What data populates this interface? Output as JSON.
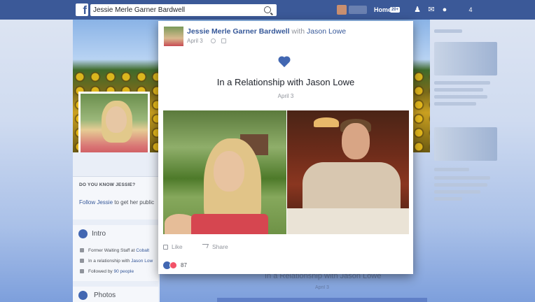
{
  "topbar": {
    "logo": "f",
    "search_value": "Jessie Merle Garner Bardwell",
    "home_label": "Home",
    "home_badge": "20+",
    "account_label": "4"
  },
  "profile": {
    "know_header": "DO YOU KNOW JESSIE?",
    "know_link": "Follow Jessie",
    "know_rest": " to get her public",
    "intro_title": "Intro",
    "intro_items": [
      {
        "text": "Former Waiting Staff at ",
        "link": "Cobalt"
      },
      {
        "text": "In a relationship with ",
        "link": "Jason Low"
      },
      {
        "text": "Followed by ",
        "link": "90 people"
      }
    ],
    "photos_title": "Photos"
  },
  "modal": {
    "author": "Jessie Merle Garner Bardwell",
    "with_prefix": " with ",
    "with_name": "Jason Lowe",
    "date": "April 3",
    "event_title": "In a Relationship with Jason Lowe",
    "event_date": "April 3",
    "like_label": "Like",
    "share_label": "Share",
    "reaction_count": "87"
  },
  "background": {
    "ghost_title": "In a Relationship with Jason Lowe",
    "ghost_date": "April 3"
  },
  "colors": {
    "brand": "#3b5998",
    "link": "#365899",
    "love": "#f25268"
  },
  "icons": [
    "search-icon",
    "friends-icon",
    "messages-icon",
    "globe-icon",
    "heart-icon",
    "like-icon",
    "share-icon"
  ]
}
